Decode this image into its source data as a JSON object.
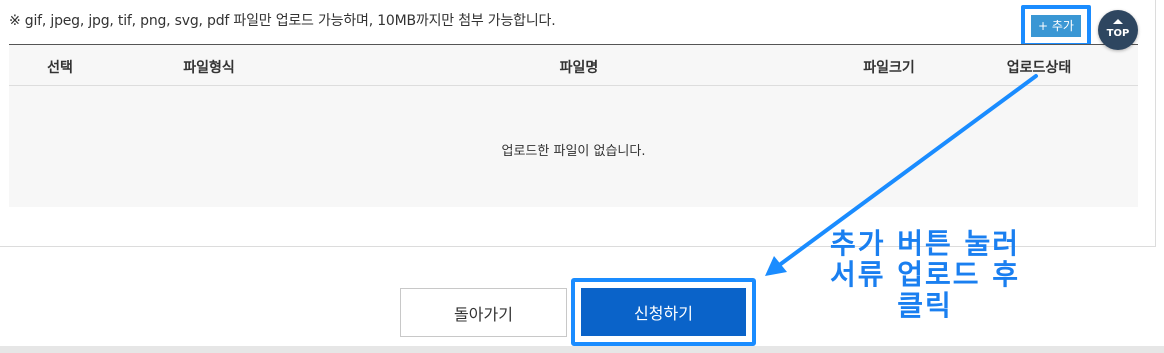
{
  "notice": "※ gif, jpeg, jpg, tif, png, svg, pdf 파일만 업로드 가능하며, 10MB까지만 첨부 가능합니다.",
  "add_button": "+ 추가",
  "top_button": "TOP",
  "table": {
    "headers": [
      "선택",
      "파일형식",
      "파일명",
      "파일크기",
      "업로드상태"
    ],
    "empty_message": "업로드한 파일이 없습니다."
  },
  "buttons": {
    "back": "돌아가기",
    "apply": "신청하기"
  },
  "annotation": "추가 버튼 눌러\n서류 업로드 후\n클릭",
  "colors": {
    "annotation": "#1a8cff",
    "apply_button": "#0a63c9",
    "add_button": "#3a97d4",
    "top_button": "#2e4660"
  },
  "icons": {
    "top": "up-triangle-icon"
  }
}
